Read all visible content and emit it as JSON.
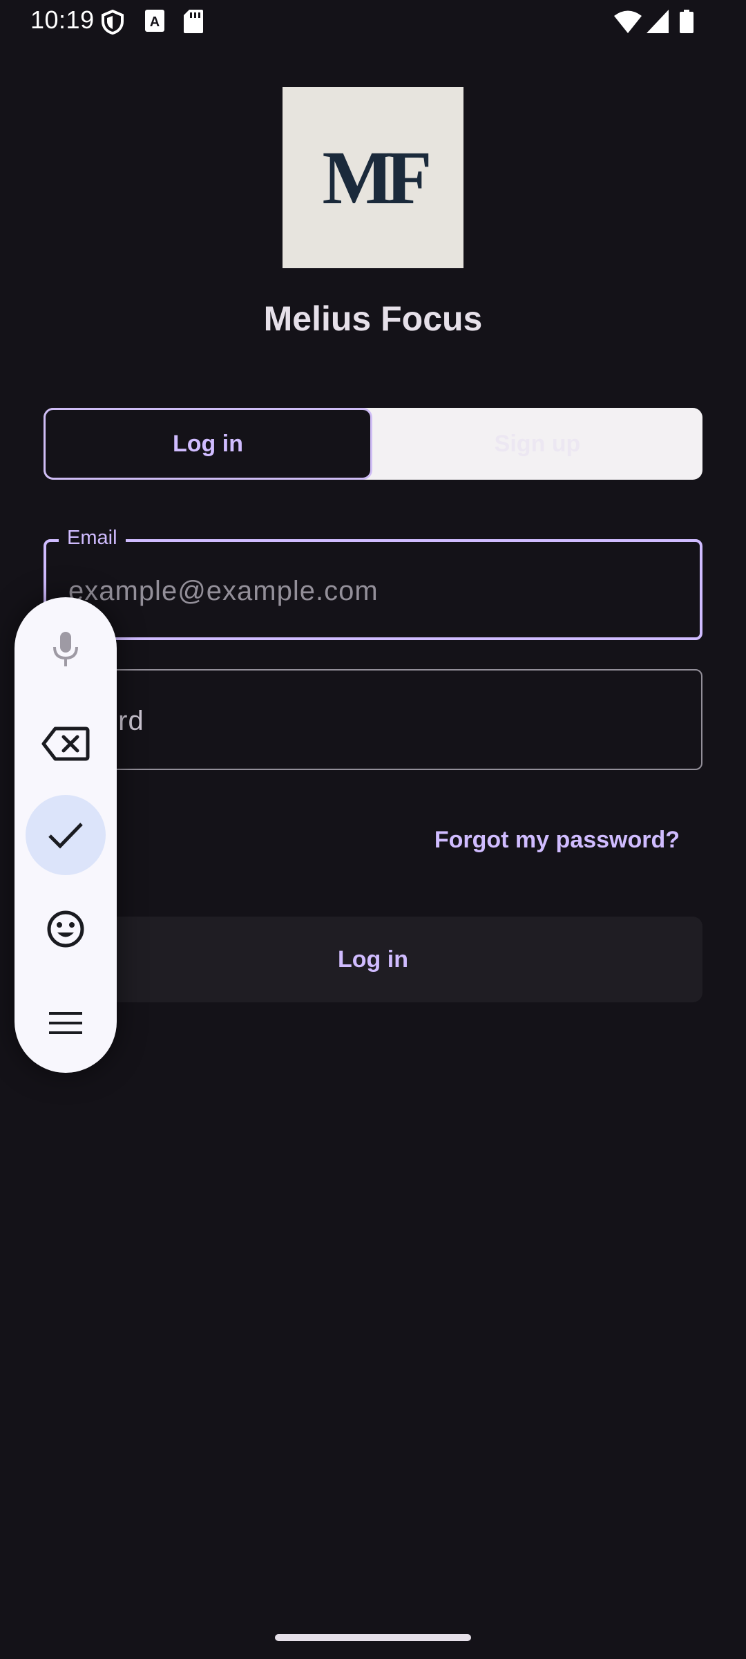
{
  "status_bar": {
    "time": "10:19",
    "icons": [
      "shield-icon",
      "a-icon",
      "sd-card-icon",
      "wifi-icon",
      "signal-icon",
      "battery-icon"
    ]
  },
  "logo": {
    "text": "MF",
    "background": "#E7E4DE",
    "color": "#1B2A3B"
  },
  "app_name": "Melius Focus",
  "auth_tabs": {
    "login_label": "Log in",
    "signup_label": "Sign up",
    "selected": "Log in"
  },
  "email_field": {
    "label": "Email",
    "placeholder": "example@example.com",
    "value": ""
  },
  "password_field": {
    "visible_text": "sword",
    "value": ""
  },
  "forgot_password_label": "Forgot my password?",
  "login_button_label": "Log in",
  "keyboard_toolbar": {
    "tools": [
      "microphone-icon",
      "backspace-icon",
      "check-icon",
      "emoji-icon",
      "menu-icon"
    ],
    "active": "check-icon"
  },
  "colors": {
    "background": "#141218",
    "accent": "#D0BCFF",
    "outline": "#938F99",
    "toolbar_bg": "#F8F7FD",
    "toolbar_active": "#DCE4FA"
  }
}
